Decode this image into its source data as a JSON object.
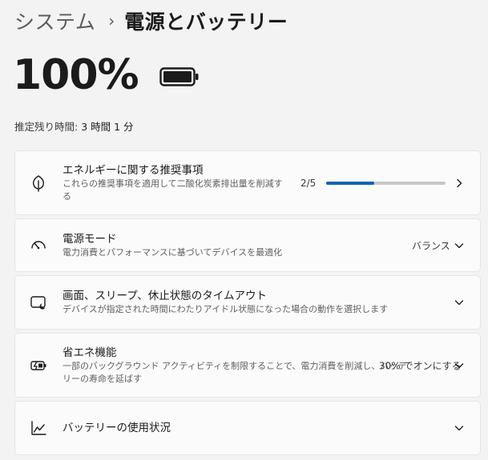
{
  "breadcrumb": {
    "parent": "システム",
    "separator": "›",
    "current": "電源とバッテリー"
  },
  "battery": {
    "percent_text": "100%",
    "level": 1.0,
    "time_label": "推定残り時間:",
    "time_value": "3 時間 1 分"
  },
  "cards": {
    "energy": {
      "icon": "leaf-icon",
      "title": "エネルギーに関する推奨事項",
      "desc": "これらの推奨事項を適用して二酸化炭素排出量を削減する",
      "count": "2/5",
      "progress": 0.4
    },
    "power_mode": {
      "icon": "gauge-icon",
      "title": "電源モード",
      "desc": "電力消費とパフォーマンスに基づいてデバイスを最適化",
      "value": "バランス"
    },
    "screen_sleep": {
      "icon": "screen-sleep-icon",
      "title": "画面、スリープ、休止状態のタイムアウト",
      "desc": "デバイスが指定された時間にわたりアイドル状態になった場合の動作を選択します"
    },
    "battery_saver": {
      "icon": "battery-saver-icon",
      "title": "省エネ機能",
      "desc_line1": "一部のバックグラウンド アクティビティを制限することで、電力消費を削減し、バッテ",
      "desc_line2": "リーの寿命を延ばす",
      "value": "30% でオンにする"
    },
    "battery_usage": {
      "icon": "usage-chart-icon",
      "title": "バッテリーの使用状況"
    }
  },
  "colors": {
    "background": "#f3f3f3",
    "card": "#fbfbfb",
    "accent": "#0f64b3"
  }
}
